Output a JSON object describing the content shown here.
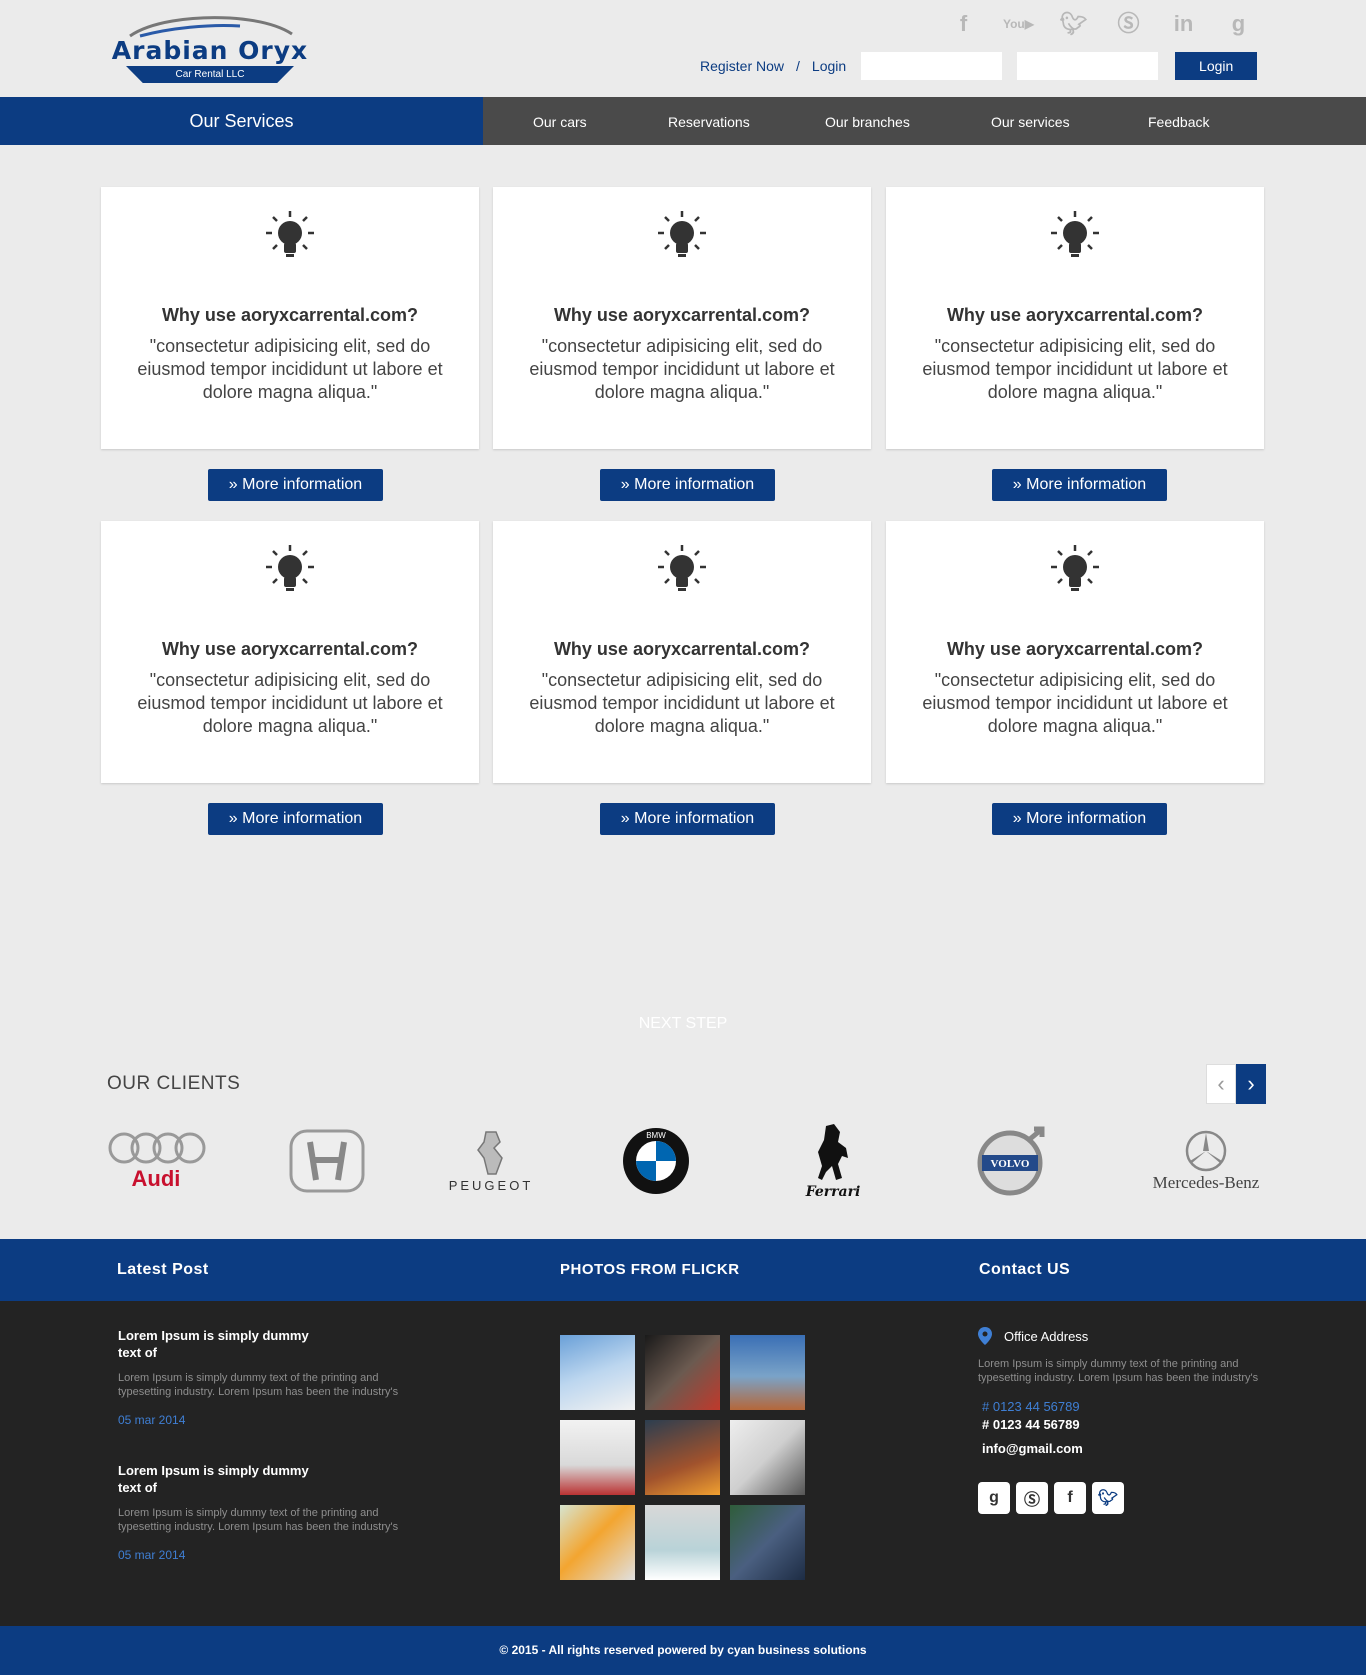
{
  "brand": {
    "name": "Arabian Oryx",
    "subtitle": "Car Rental LLC"
  },
  "header": {
    "social_icons": [
      "facebook-icon",
      "youtube-icon",
      "twitter-icon",
      "skype-icon",
      "linkedin-icon",
      "google-plus-icon"
    ],
    "register_label": "Register Now",
    "separator": "/",
    "login_link": "Login",
    "login_button": "Login"
  },
  "nav": {
    "active": "Our Services",
    "items": [
      "Our cars",
      "Reservations",
      "Our branches",
      "Our services",
      "Feedback"
    ]
  },
  "cards": [
    {
      "title": "Why use aoryxcarrental.com?",
      "text": "\"consectetur adipisicing elit, sed do eiusmod tempor incididunt ut labore et dolore magna aliqua.\"",
      "button": "» More information"
    },
    {
      "title": "Why use aoryxcarrental.com?",
      "text": "\"consectetur adipisicing elit, sed do eiusmod tempor incididunt ut labore et dolore magna aliqua.\"",
      "button": "» More information"
    },
    {
      "title": "Why use aoryxcarrental.com?",
      "text": "\"consectetur adipisicing elit, sed do eiusmod tempor incididunt ut labore et dolore magna aliqua.\"",
      "button": "» More information"
    },
    {
      "title": "Why use aoryxcarrental.com?",
      "text": "\"consectetur adipisicing elit, sed do eiusmod tempor incididunt ut labore et dolore magna aliqua.\"",
      "button": "» More information"
    },
    {
      "title": "Why use aoryxcarrental.com?",
      "text": "\"consectetur adipisicing elit, sed do eiusmod tempor incididunt ut labore et dolore magna aliqua.\"",
      "button": "» More information"
    },
    {
      "title": "Why use aoryxcarrental.com?",
      "text": "\"consectetur adipisicing elit, sed do eiusmod tempor incididunt ut labore et dolore magna aliqua.\"",
      "button": "» More information"
    }
  ],
  "next_step": "NEXT STEP",
  "clients": {
    "title": "OUR CLIENTS",
    "logos": [
      "Audi",
      "Honda",
      "PEUGEOT",
      "BMW",
      "Ferrari",
      "VOLVO",
      "Mercedes-Benz"
    ]
  },
  "footer": {
    "latest_post_title": "Latest Post",
    "flickr_title": "PHOTOS FROM FLICKR",
    "contact_title": "Contact US",
    "posts": [
      {
        "title": "Lorem Ipsum is simply dummy text of",
        "text": "Lorem Ipsum is simply dummy text of the printing and typesetting industry. Lorem Ipsum has been the industry's",
        "date": "05 mar 2014"
      },
      {
        "title": "Lorem Ipsum is simply dummy text of",
        "text": "Lorem Ipsum is simply dummy text of the printing and typesetting industry. Lorem Ipsum has been the industry's",
        "date": "05 mar 2014"
      }
    ],
    "contact": {
      "address_title": "Office Address",
      "address_text": "Lorem Ipsum is simply dummy text of the printing and typesetting industry. Lorem Ipsum has been the industry's",
      "phone1": "# 0123 44 56789",
      "phone2": "# 0123 44 56789",
      "email": "info@gmail.com",
      "socials": [
        "google-plus-icon",
        "skype-icon",
        "facebook-icon",
        "twitter-icon"
      ]
    },
    "copyright": "© 2015 - All rights reserved powered by cyan business solutions"
  },
  "colors": {
    "primary": "#0c3c82",
    "nav_bg": "#4a4a4a",
    "footer_bg": "#232323",
    "page_bg": "#ebebeb"
  }
}
